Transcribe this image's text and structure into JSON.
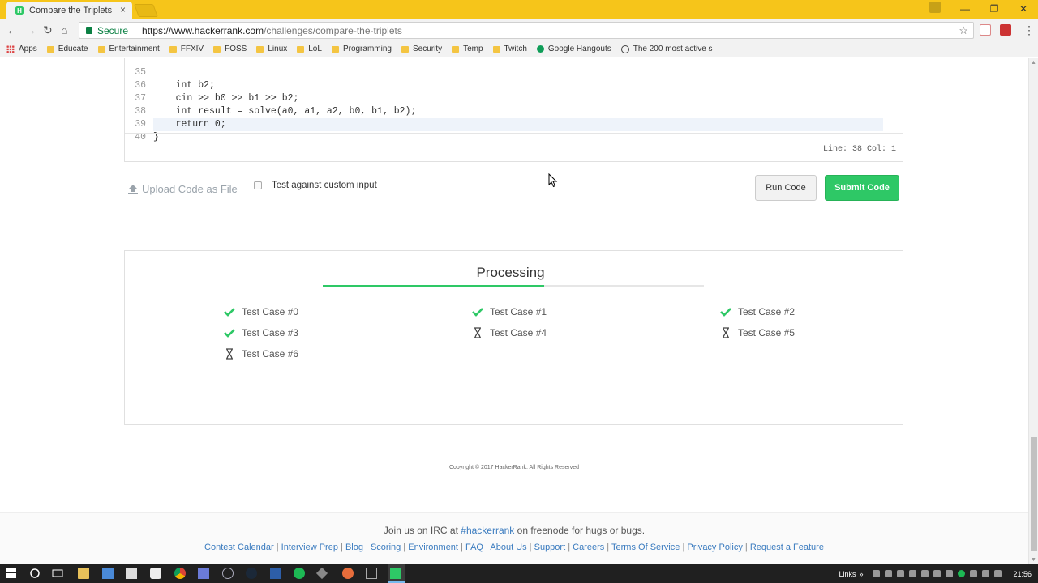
{
  "browser": {
    "tab_title": "Compare the Triplets | Al",
    "tab_favicon": "H",
    "tab_close": "×",
    "secure_label": "Secure",
    "url_scheme_host": "https://www.hackerrank.com",
    "url_path": "/challenges/compare-the-triplets",
    "window_controls": [
      "—",
      "❐",
      "✕"
    ]
  },
  "bookmarks": [
    {
      "label": "Apps",
      "icon": "apps-grid-icon"
    },
    {
      "label": "Educate",
      "icon": "folder-icon"
    },
    {
      "label": "Entertainment",
      "icon": "folder-icon"
    },
    {
      "label": "FFXIV",
      "icon": "folder-icon"
    },
    {
      "label": "FOSS",
      "icon": "folder-icon"
    },
    {
      "label": "Linux",
      "icon": "folder-icon"
    },
    {
      "label": "LoL",
      "icon": "folder-icon"
    },
    {
      "label": "Programming",
      "icon": "folder-icon"
    },
    {
      "label": "Security",
      "icon": "folder-icon"
    },
    {
      "label": "Temp",
      "icon": "folder-icon"
    },
    {
      "label": "Twitch",
      "icon": "folder-icon"
    },
    {
      "label": "Google Hangouts",
      "icon": "hangouts-icon"
    },
    {
      "label": "The 200 most active s",
      "icon": "github-icon"
    }
  ],
  "editor": {
    "lines": [
      {
        "num": "35",
        "code": "    int b2;"
      },
      {
        "num": "36",
        "code": "    cin >> b0 >> b1 >> b2;"
      },
      {
        "num": "37",
        "code": "    int result = solve(a0, a1, a2, b0, b1, b2);"
      },
      {
        "num": "38",
        "code": "    return 0;"
      },
      {
        "num": "39",
        "code": "}"
      },
      {
        "num": "40",
        "code": ""
      }
    ],
    "cursor_pos": "Line: 38 Col: 1"
  },
  "actions": {
    "upload_label": "Upload Code as File",
    "custom_input_label": "Test against custom input",
    "run_label": "Run Code",
    "submit_label": "Submit Code"
  },
  "processing": {
    "title": "Processing",
    "progress_fraction": 0.58,
    "accent_color": "#2ec866",
    "test_cases": [
      {
        "label": "Test Case #0",
        "status": "passed"
      },
      {
        "label": "Test Case #1",
        "status": "passed"
      },
      {
        "label": "Test Case #2",
        "status": "passed"
      },
      {
        "label": "Test Case #3",
        "status": "passed"
      },
      {
        "label": "Test Case #4",
        "status": "pending"
      },
      {
        "label": "Test Case #5",
        "status": "pending"
      },
      {
        "label": "Test Case #6",
        "status": "pending"
      }
    ]
  },
  "footer": {
    "copyright": "Copyright © 2017 HackerRank. All Rights Reserved",
    "irc_prefix": "Join us on IRC at",
    "irc_channel": "#hackerrank",
    "irc_suffix": "on freenode for hugs or bugs.",
    "links": [
      "Contest Calendar",
      "Interview Prep",
      "Blog",
      "Scoring",
      "Environment",
      "FAQ",
      "About Us",
      "Support",
      "Careers",
      "Terms Of Service",
      "Privacy Policy",
      "Request a Feature"
    ]
  },
  "taskbar": {
    "links_label": "Links",
    "chevron": "»",
    "clock": "21:56"
  }
}
